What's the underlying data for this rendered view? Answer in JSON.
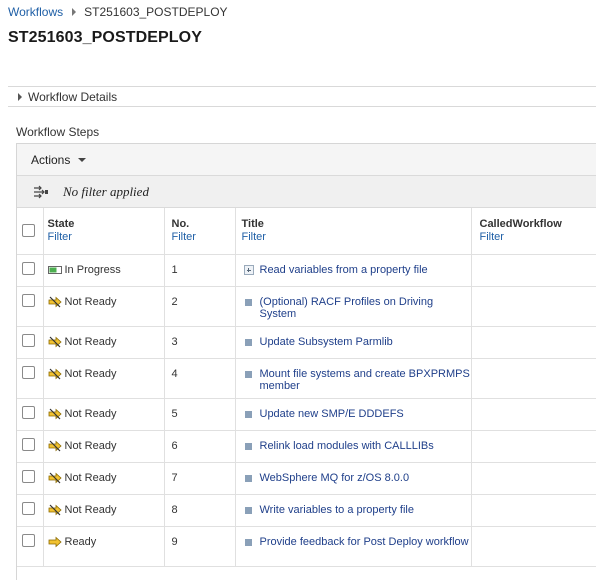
{
  "breadcrumb": {
    "root": "Workflows",
    "current": "ST251603_POSTDEPLOY"
  },
  "page_title": "ST251603_POSTDEPLOY",
  "details_label": "Workflow Details",
  "steps_section_label": "Workflow Steps",
  "toolbar": {
    "actions_label": "Actions"
  },
  "filter_status": "No filter applied",
  "columns": {
    "state": {
      "label": "State",
      "filter": "Filter"
    },
    "no": {
      "label": "No.",
      "filter": "Filter"
    },
    "title": {
      "label": "Title",
      "filter": "Filter"
    },
    "called": {
      "label": "CalledWorkflow",
      "filter": "Filter"
    }
  },
  "colors": {
    "link": "#1f5fa6",
    "title_link": "#1f3f8a",
    "in_progress": "#4caf50",
    "not_ready": "#e0b020",
    "ready": "#e8b81a"
  },
  "rows": [
    {
      "state": "In Progress",
      "state_icon": "in-progress-icon",
      "no": "1",
      "title": "Read variables from a property file",
      "title_icon": "expand-icon",
      "called": ""
    },
    {
      "state": "Not Ready",
      "state_icon": "not-ready-icon",
      "no": "2",
      "title": "(Optional) RACF Profiles on Driving System",
      "title_icon": "step-icon",
      "called": ""
    },
    {
      "state": "Not Ready",
      "state_icon": "not-ready-icon",
      "no": "3",
      "title": "Update Subsystem Parmlib",
      "title_icon": "step-icon",
      "called": ""
    },
    {
      "state": "Not Ready",
      "state_icon": "not-ready-icon",
      "no": "4",
      "title": "Mount file systems and create BPXPRMPS member",
      "title_icon": "step-icon",
      "called": ""
    },
    {
      "state": "Not Ready",
      "state_icon": "not-ready-icon",
      "no": "5",
      "title": "Update new SMP/E DDDEFS",
      "title_icon": "step-icon",
      "called": ""
    },
    {
      "state": "Not Ready",
      "state_icon": "not-ready-icon",
      "no": "6",
      "title": "Relink load modules with CALLLIBs",
      "title_icon": "step-icon",
      "called": ""
    },
    {
      "state": "Not Ready",
      "state_icon": "not-ready-icon",
      "no": "7",
      "title": "WebSphere MQ for z/OS 8.0.0",
      "title_icon": "step-icon",
      "called": ""
    },
    {
      "state": "Not Ready",
      "state_icon": "not-ready-icon",
      "no": "8",
      "title": "Write variables to a property file",
      "title_icon": "step-icon",
      "called": ""
    },
    {
      "state": "Ready",
      "state_icon": "ready-icon",
      "no": "9",
      "title": "Provide feedback for Post Deploy workflow",
      "title_icon": "step-icon",
      "called": ""
    }
  ]
}
